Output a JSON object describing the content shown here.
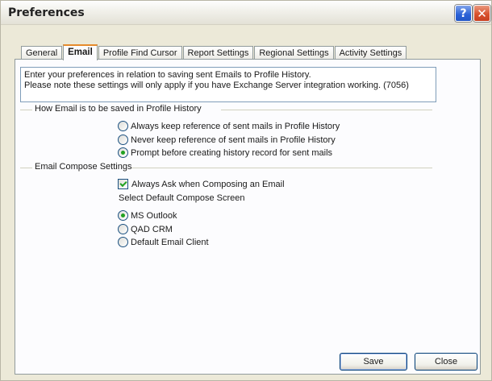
{
  "window": {
    "title": "Preferences",
    "help_glyph": "?",
    "close_glyph": "✕",
    "icons": {
      "help": "help-icon",
      "close": "close-icon"
    },
    "colors": {
      "help_button": "#2a61d6",
      "close_button": "#d9532e",
      "active_tab_accent": "#e68b2c",
      "check_mark": "#21a121"
    }
  },
  "tabs": [
    {
      "label": "General",
      "active": false
    },
    {
      "label": "Email",
      "active": true
    },
    {
      "label": "Profile Find Cursor",
      "active": false
    },
    {
      "label": "Report Settings",
      "active": false
    },
    {
      "label": "Regional Settings",
      "active": false
    },
    {
      "label": "Activity Settings",
      "active": false
    }
  ],
  "info": {
    "line1": "Enter your preferences in relation to saving sent Emails to Profile History.",
    "line2": "Please note these settings will only apply if you have Exchange Server integration working. (7056)"
  },
  "history_group": {
    "label": "How Email is to be saved in Profile History",
    "options": [
      {
        "label": "Always keep reference of sent mails in Profile History",
        "checked": false
      },
      {
        "label": "Never keep reference of sent mails in Profile History",
        "checked": false
      },
      {
        "label": "Prompt before creating history record for sent mails",
        "checked": true
      }
    ]
  },
  "compose_group": {
    "label": "Email Compose Settings",
    "always_ask": {
      "label": "Always Ask when Composing an Email",
      "checked": true
    },
    "select_label": "Select Default Compose Screen",
    "options": [
      {
        "label": "MS Outlook",
        "checked": true
      },
      {
        "label": "QAD CRM",
        "checked": false
      },
      {
        "label": "Default Email Client",
        "checked": false
      }
    ]
  },
  "buttons": {
    "save": "Save",
    "close": "Close"
  }
}
